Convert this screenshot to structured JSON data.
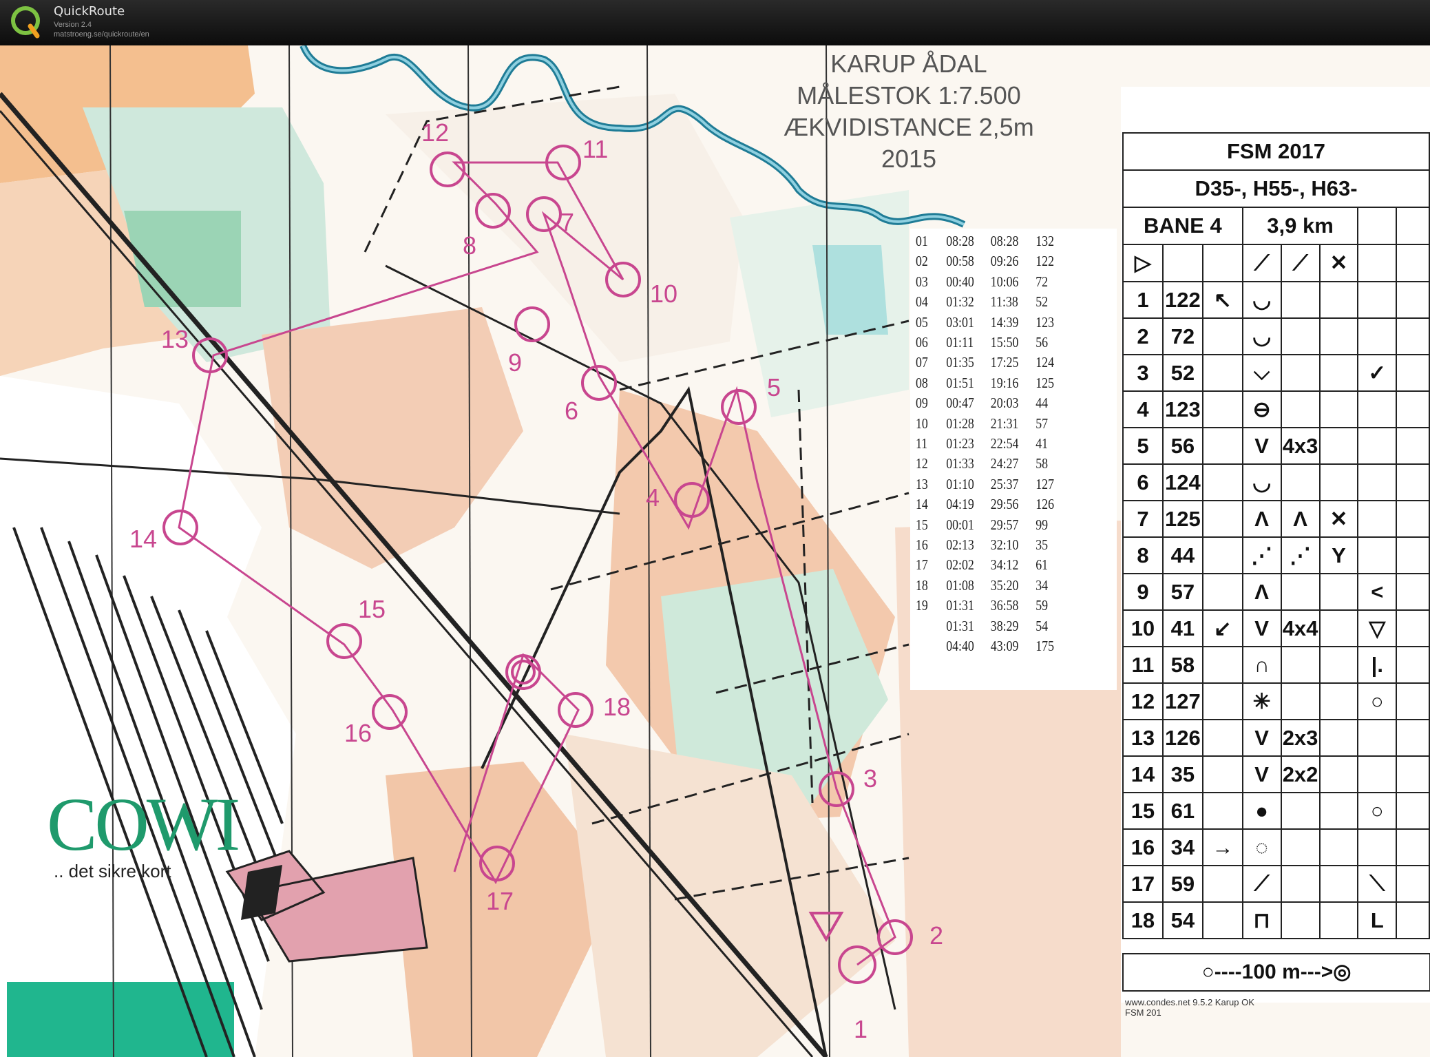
{
  "app": {
    "name": "QuickRoute",
    "version": "Version 2.4",
    "url": "matstroeng.se/quickroute/en"
  },
  "map_title": {
    "line1": "KARUP ÅDAL",
    "line2": "MÅLESTOK 1:7.500",
    "line3": "ÆKVIDISTANCE 2,5m",
    "line4": "2015"
  },
  "brand": {
    "logo": "COWI",
    "tagline": ".. det sikre kort",
    "color": "#1f9a6c"
  },
  "course_color": "#c8468f",
  "control_labels": [
    "1",
    "2",
    "3",
    "4",
    "5",
    "6",
    "7",
    "8",
    "9",
    "10",
    "11",
    "12",
    "13",
    "14",
    "15",
    "16",
    "17",
    "18"
  ],
  "splits": [
    {
      "leg": "01",
      "split": "08:28",
      "total": "08:28",
      "code": "132"
    },
    {
      "leg": "02",
      "split": "00:58",
      "total": "09:26",
      "code": "122"
    },
    {
      "leg": "03",
      "split": "00:40",
      "total": "10:06",
      "code": "72"
    },
    {
      "leg": "04",
      "split": "01:32",
      "total": "11:38",
      "code": "52"
    },
    {
      "leg": "05",
      "split": "03:01",
      "total": "14:39",
      "code": "123"
    },
    {
      "leg": "06",
      "split": "01:11",
      "total": "15:50",
      "code": "56"
    },
    {
      "leg": "07",
      "split": "01:35",
      "total": "17:25",
      "code": "124"
    },
    {
      "leg": "08",
      "split": "01:51",
      "total": "19:16",
      "code": "125"
    },
    {
      "leg": "09",
      "split": "00:47",
      "total": "20:03",
      "code": "44"
    },
    {
      "leg": "10",
      "split": "01:28",
      "total": "21:31",
      "code": "57"
    },
    {
      "leg": "11",
      "split": "01:23",
      "total": "22:54",
      "code": "41"
    },
    {
      "leg": "12",
      "split": "01:33",
      "total": "24:27",
      "code": "58"
    },
    {
      "leg": "13",
      "split": "01:10",
      "total": "25:37",
      "code": "127"
    },
    {
      "leg": "14",
      "split": "04:19",
      "total": "29:56",
      "code": "126"
    },
    {
      "leg": "15",
      "split": "00:01",
      "total": "29:57",
      "code": "99"
    },
    {
      "leg": "16",
      "split": "02:13",
      "total": "32:10",
      "code": "35"
    },
    {
      "leg": "17",
      "split": "02:02",
      "total": "34:12",
      "code": "61"
    },
    {
      "leg": "18",
      "split": "01:08",
      "total": "35:20",
      "code": "34"
    },
    {
      "leg": "19",
      "split": "01:31",
      "total": "36:58",
      "code": "59"
    },
    {
      "leg": "",
      "split": "01:31",
      "total": "38:29",
      "code": "54"
    },
    {
      "leg": "",
      "split": "04:40",
      "total": "43:09",
      "code": "175"
    }
  ],
  "control_description": {
    "event": "FSM 2017",
    "classes": "D35-, H55-, H63-",
    "course": "BANE 4",
    "length": "3,9 km",
    "start_symbol": "▷",
    "start_symbols": [
      "⟋",
      "⟋",
      "✕"
    ],
    "rows": [
      {
        "n": "1",
        "code": "122",
        "c": "↖",
        "d": "◡",
        "e": "",
        "f": "",
        "g": ""
      },
      {
        "n": "2",
        "code": "72",
        "c": "",
        "d": "◡",
        "e": "",
        "f": "",
        "g": ""
      },
      {
        "n": "3",
        "code": "52",
        "c": "",
        "d": "⌵",
        "e": "",
        "f": "",
        "g": "✓"
      },
      {
        "n": "4",
        "code": "123",
        "c": "",
        "d": "⊖",
        "e": "",
        "f": "",
        "g": ""
      },
      {
        "n": "5",
        "code": "56",
        "c": "",
        "d": "V",
        "e": "4x3",
        "f": "",
        "g": ""
      },
      {
        "n": "6",
        "code": "124",
        "c": "",
        "d": "◡",
        "e": "",
        "f": "",
        "g": ""
      },
      {
        "n": "7",
        "code": "125",
        "c": "",
        "d": "Λ",
        "e": "Λ",
        "f": "✕",
        "g": ""
      },
      {
        "n": "8",
        "code": "44",
        "c": "",
        "d": "⋰",
        "e": "⋰",
        "f": "Y",
        "g": ""
      },
      {
        "n": "9",
        "code": "57",
        "c": "",
        "d": "Λ",
        "e": "",
        "f": "",
        "g": "<"
      },
      {
        "n": "10",
        "code": "41",
        "c": "↙",
        "d": "V",
        "e": "4x4",
        "f": "",
        "g": "▽"
      },
      {
        "n": "11",
        "code": "58",
        "c": "",
        "d": "∩",
        "e": "",
        "f": "",
        "g": "|."
      },
      {
        "n": "12",
        "code": "127",
        "c": "",
        "d": "✳",
        "e": "",
        "f": "",
        "g": "○"
      },
      {
        "n": "13",
        "code": "126",
        "c": "",
        "d": "V",
        "e": "2x3",
        "f": "",
        "g": ""
      },
      {
        "n": "14",
        "code": "35",
        "c": "",
        "d": "V",
        "e": "2x2",
        "f": "",
        "g": ""
      },
      {
        "n": "15",
        "code": "61",
        "c": "",
        "d": "●",
        "e": "",
        "f": "",
        "g": "○"
      },
      {
        "n": "16",
        "code": "34",
        "c": "→",
        "d": "◌",
        "e": "",
        "f": "",
        "g": ""
      },
      {
        "n": "17",
        "code": "59",
        "c": "",
        "d": "⟋",
        "e": "",
        "f": "",
        "g": "⟍"
      },
      {
        "n": "18",
        "code": "54",
        "c": "",
        "d": "⊓",
        "e": "",
        "f": "",
        "g": "L"
      }
    ],
    "finish": "○----100 m--->◎",
    "footer": "www.condes.net 9.5.2 Karup OK",
    "footer2": "FSM 201"
  }
}
